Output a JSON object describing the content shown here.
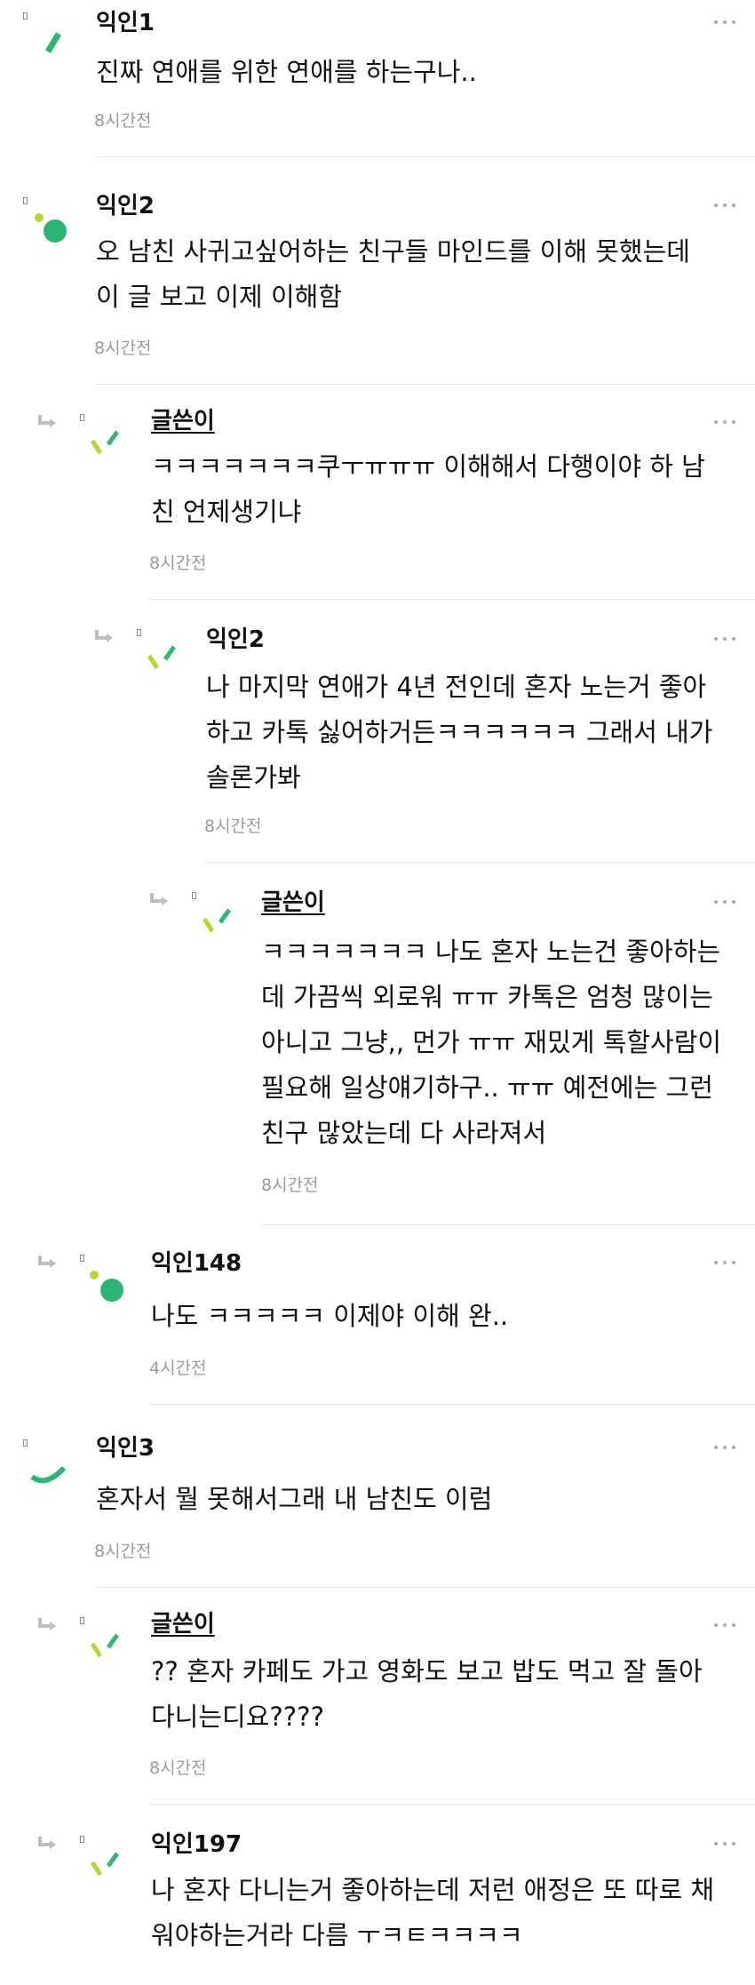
{
  "comments": [
    {
      "name": "익인1",
      "lines": [
        "진짜 연애를 위한 연애를 하는구나.."
      ],
      "time": "8시간전",
      "avatar": "green-slash-icon"
    },
    {
      "name": "익인2",
      "lines": [
        "오 남친 사귀고싶어하는 친구들 마인드를 이해 못했는데",
        "이 글 보고 이제 이해함"
      ],
      "time": "8시간전",
      "avatar": "dots-icon"
    },
    {
      "name": "글쓴이",
      "lines": [
        "ㅋㅋㅋㅋㅋㅋㅋ쿠ㅜㅠㅠㅠ 이해해서 다행이야 하 남",
        "친 언제생기냐"
      ],
      "time": "8시간전",
      "avatar": "yellow-green-slash-icon"
    },
    {
      "name": "익인2",
      "lines": [
        "나 마지막 연애가 4년 전인데 혼자 노는거 좋아",
        "하고 카톡 싫어하거든ㅋㅋㅋㅋㅋㅋ 그래서 내가",
        "솔론가봐"
      ],
      "time": "8시간전",
      "avatar": "yellow-green-slash-icon"
    },
    {
      "name": "글쓴이",
      "lines": [
        "ㅋㅋㅋㅋㅋㅋㅋ 나도 혼자 노는건 좋아하는",
        "데 가끔씩 외로워 ㅠㅠ 카톡은 엄청 많이는",
        "아니고 그냥,, 먼가 ㅠㅠ 재밌게 톡할사람이",
        "필요해 일상얘기하구.. ㅠㅠ 예전에는 그런",
        "친구 많았는데 다 사라져서"
      ],
      "time": "8시간전",
      "avatar": "yellow-green-slash-icon"
    },
    {
      "name": "익인148",
      "lines": [
        "나도 ㅋㅋㅋㅋㅋ 이제야 이해 완.."
      ],
      "time": "4시간전",
      "avatar": "dots-icon"
    },
    {
      "name": "익인3",
      "lines": [
        "혼자서 뭘 못해서그래 내 남친도 이럼"
      ],
      "time": "8시간전",
      "avatar": "green-arc-icon"
    },
    {
      "name": "글쓴이",
      "lines": [
        "?? 혼자 카페도 가고 영화도 보고 밥도 먹고 잘 돌아",
        "다니는디요????"
      ],
      "time": "8시간전",
      "avatar": "yellow-green-slash-icon"
    },
    {
      "name": "익인197",
      "lines": [
        "나 혼자 다니는거 좋아하는데 저런 애정은 또 따로 채",
        "워야하는거라 다름 ㅜㅋㅌㅋㅋㅋㅋ"
      ],
      "time": "",
      "avatar": "yellow-green-slash-icon"
    }
  ],
  "colors": {
    "green": "#2bb673",
    "light_green": "#b9d62f",
    "time_gray": "#9a9a9a",
    "divider": "#e8e8e8"
  }
}
